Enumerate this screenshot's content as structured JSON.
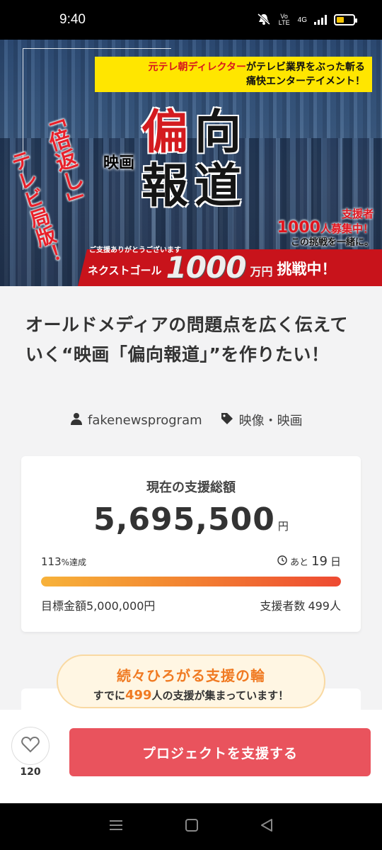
{
  "status": {
    "time": "9:40",
    "network": "4G",
    "volte": "Vo LTE"
  },
  "banner": {
    "tagline_red": "元テレ朝ディレクター",
    "tagline_rest": "がテレビ業界をぶった斬る",
    "tagline_line2": "痛快エンターテイメント！",
    "vertical_1": "「倍返し」",
    "vertical_2": "テレビ局版！",
    "eiga": "映画",
    "title_chars": [
      "偏",
      "向",
      "報",
      "道"
    ],
    "supporter_label": "支援者",
    "supporter_count": "1000",
    "supporter_recruit": "人募集中！",
    "supporter_sub": "この挑戦を一緒に。",
    "goal_thanks": "ご支援ありがとうございます",
    "goal_next": "ネクストゴール",
    "goal_amount": "1000",
    "goal_unit": "万円",
    "goal_challenge": "挑戦中！"
  },
  "project": {
    "title": "オールドメディアの問題点を広く伝えていく“映画「偏向報道」”を作りたい！",
    "owner": "fakenewsprogram",
    "category": "映像・映画"
  },
  "funding": {
    "label": "現在の支援総額",
    "amount": "5,695,500",
    "currency": "円",
    "rate_num": "113",
    "rate_suffix": "%達成",
    "remain_prefix": "あと",
    "remain_days": "19",
    "remain_unit": "日",
    "progress_fraction": 1.0,
    "goal_label": "目標金額5,000,000円",
    "backers_label": "支援者数",
    "backers_count": "499",
    "backers_unit": "人"
  },
  "bubble": {
    "heading": "続々ひろがる支援の輪",
    "pre": "すでに",
    "count": "499",
    "post": "人の支援が集まっています！"
  },
  "actions": {
    "like_count": "120",
    "support_label": "プロジェクトを支援する"
  },
  "colors": {
    "accent": "#e9535d",
    "progress_start": "#f7b23a",
    "progress_end": "#ee4a32",
    "bubble_text": "#f07a22"
  }
}
